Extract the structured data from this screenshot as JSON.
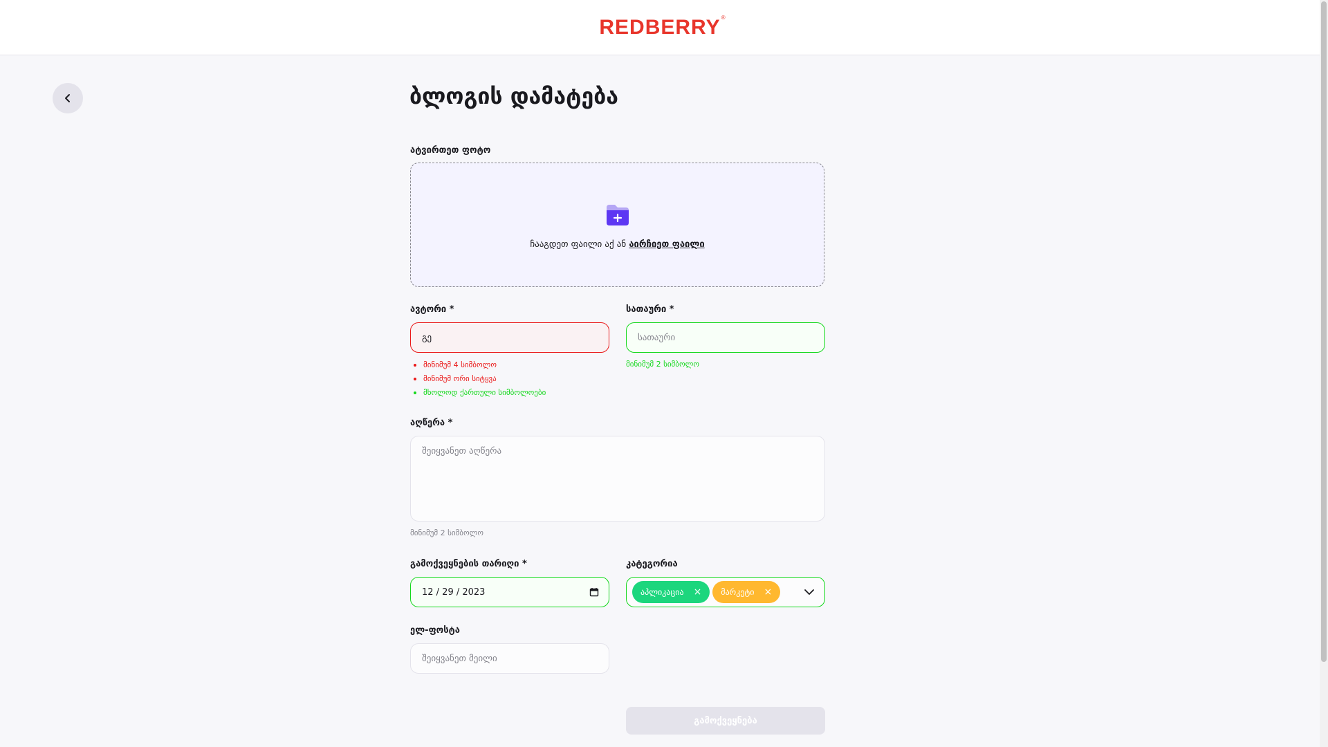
{
  "header": {
    "logo_text": "REDBERRY",
    "logo_mark": "®",
    "logo_color": "#E8352B"
  },
  "page": {
    "title": "ბლოგის დამატება",
    "back_icon": "chevron-left-icon"
  },
  "upload": {
    "label": "ატვირთეთ ფოტო",
    "icon": "folder-add-icon",
    "text": "ჩააგდეთ ფაილი აქ ან",
    "choose_link": "აირჩიეთ ფაილი"
  },
  "author": {
    "label": "ავტორი *",
    "value": "გე",
    "rules": [
      {
        "text": "მინიმუმ 4 სიმბოლო",
        "status": "error"
      },
      {
        "text": "მინიმუმ ორი სიტყვა",
        "status": "error"
      },
      {
        "text": "მხოლოდ ქართული სიმბოლოები",
        "status": "valid"
      }
    ]
  },
  "title_field": {
    "label": "სათაური *",
    "placeholder": "სათაური",
    "hint": "მინიმუმ 2 სიმბოლო"
  },
  "description": {
    "label": "აღწერა *",
    "placeholder": "შეიყვანეთ აღწერა",
    "hint": "მინიმუმ 2 სიმბოლო"
  },
  "publish_date": {
    "label": "გამოქვეყნების თარიღი *",
    "value": "12 / 29 / 2023",
    "icon": "calendar-icon"
  },
  "category": {
    "label": "კატეგორია",
    "chips": [
      {
        "text": "აპლიკაცია",
        "color": "#1CD67D"
      },
      {
        "text": "მარკეტი",
        "color": "#FFB82F"
      }
    ],
    "dropdown_icon": "chevron-down-icon"
  },
  "email": {
    "label": "ელ-ფოსტა",
    "placeholder": "შეიყვანეთ მეილი"
  },
  "submit": {
    "label": "გამოქვეყნება"
  },
  "colors": {
    "accent": "#5D37F3",
    "error": "#EA1919",
    "valid": "#14D81C"
  }
}
